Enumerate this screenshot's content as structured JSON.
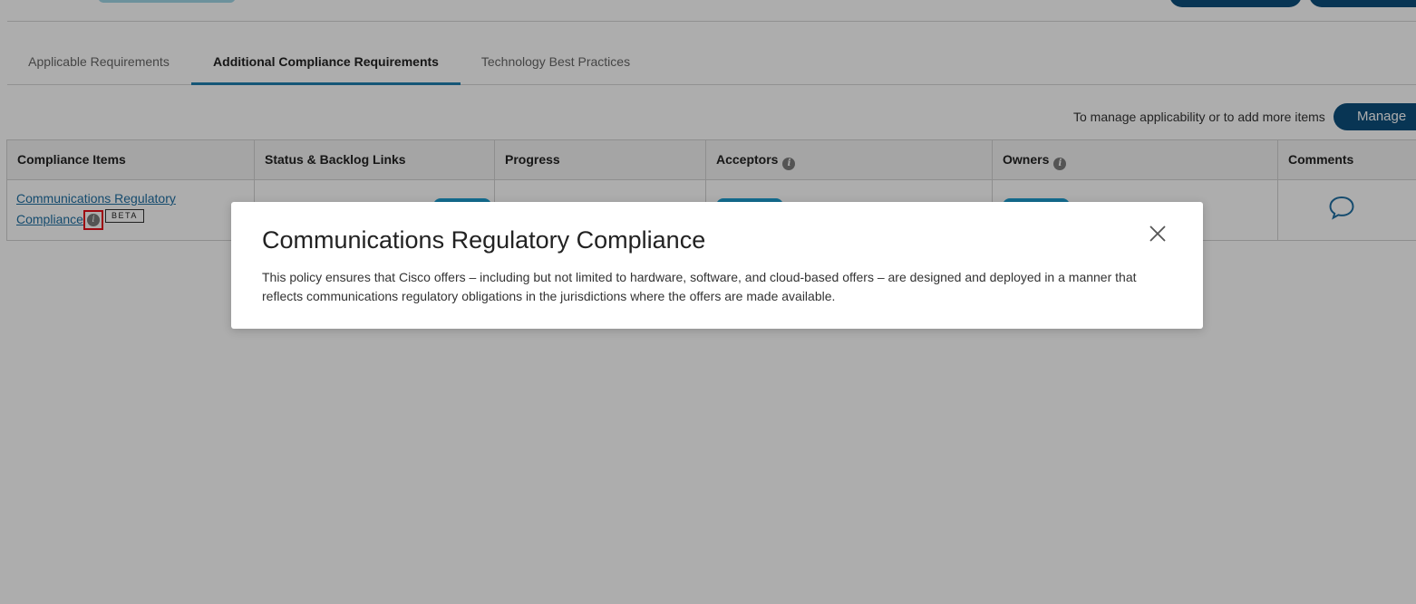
{
  "tabs": [
    {
      "label": "Applicable Requirements",
      "active": false
    },
    {
      "label": "Additional Compliance Requirements",
      "active": true
    },
    {
      "label": "Technology Best Practices",
      "active": false
    }
  ],
  "manage": {
    "hint": "To manage applicability or to add more items",
    "button_label": "Manage"
  },
  "table": {
    "headers": [
      "Compliance Items",
      "Status & Backlog Links",
      "Progress",
      "Acceptors",
      "Owners",
      "Comments"
    ],
    "rows": [
      {
        "item_line1": "Communications Regulatory",
        "item_line2": "Compliance",
        "badge": "BETA"
      }
    ]
  },
  "modal": {
    "title": "Communications Regulatory Compliance",
    "body": "This policy ensures that Cisco offers – including but not limited to hardware, software, and cloud-based offers – are designed and deployed in a manner that reflects communications regulatory obligations in the jurisdictions where the offers are made available."
  },
  "icons": {
    "info": "info-icon",
    "close": "close-icon",
    "comment": "comment-bubble-icon"
  },
  "colors": {
    "accent": "#1f7fb0",
    "primary_button": "#0d4f7c",
    "link": "#1f6fa3",
    "highlight": "#e8101a",
    "pill": "#1d9fd3"
  }
}
